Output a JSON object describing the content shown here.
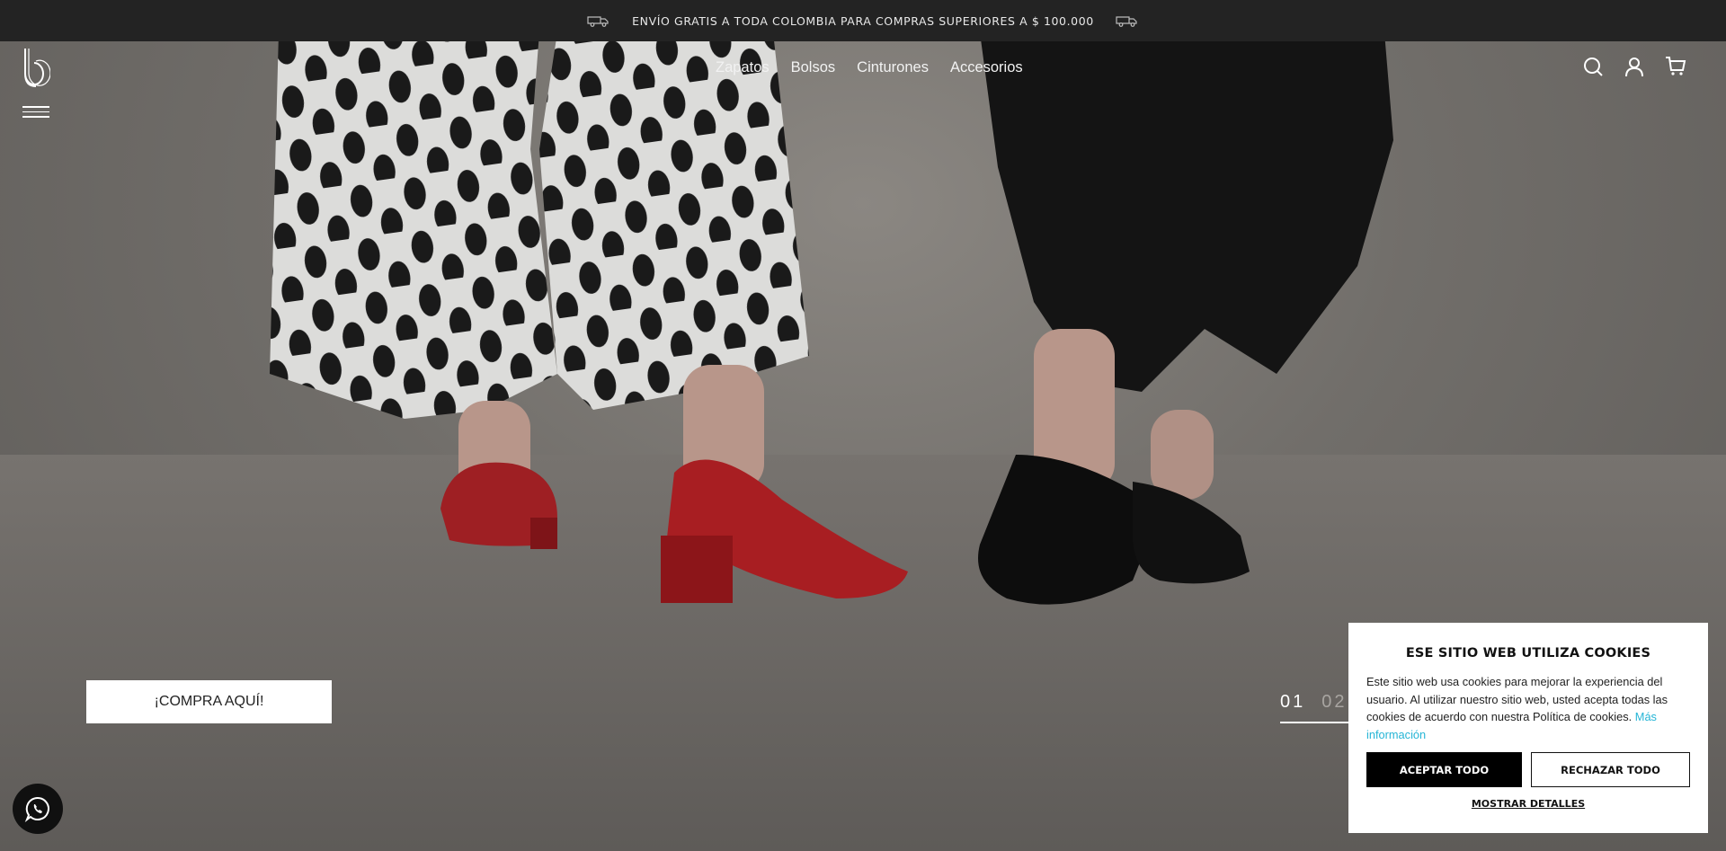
{
  "announcement": {
    "text": "ENVÍO GRATIS A TODA COLOMBIA PARA COMPRAS SUPERIORES A $ 100.000",
    "icon": "truck-icon"
  },
  "header": {
    "logo_icon": "brand-logo-b",
    "menu_icon": "hamburger-icon",
    "nav": [
      {
        "label": "Zapatos"
      },
      {
        "label": "Bolsos"
      },
      {
        "label": "Cinturones"
      },
      {
        "label": "Accesorios"
      }
    ],
    "icons": [
      "search-icon",
      "user-icon",
      "cart-icon"
    ]
  },
  "hero": {
    "cta_label": "¡COMPRA AQUÍ!",
    "slides": [
      "01",
      "02"
    ],
    "active_slide": "01"
  },
  "whatsapp": {
    "icon": "whatsapp-icon"
  },
  "cookies": {
    "title": "ESE SITIO WEB UTILIZA COOKIES",
    "body": "Este sitio web usa cookies para mejorar la experiencia del usuario. Al utilizar nuestro sitio web, usted acepta todas las cookies de acuerdo con nuestra Política de cookies.",
    "more_link": "Más información",
    "accept_label": "ACEPTAR TODO",
    "reject_label": "RECHAZAR TODO",
    "details_label": "MOSTRAR DETALLES"
  },
  "colors": {
    "topbar": "#232323",
    "link_accent": "#25b5d6"
  }
}
